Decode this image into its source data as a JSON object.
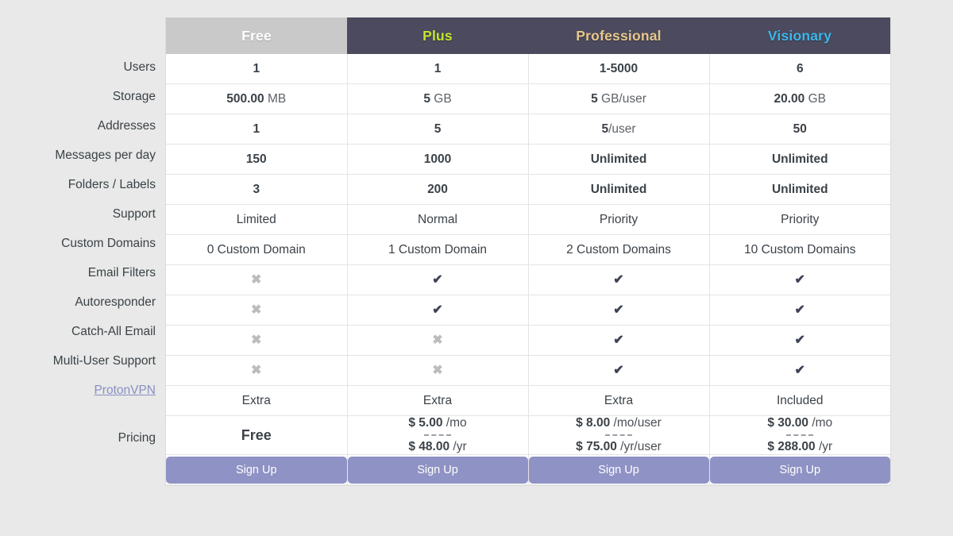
{
  "table": {
    "plans": [
      {
        "key": "free",
        "name": "Free",
        "name_color": "#ffffff",
        "header_bg": "#c9c9c9"
      },
      {
        "key": "plus",
        "name": "Plus",
        "name_color": "#c3e62e",
        "header_bg": "#4b4a5e"
      },
      {
        "key": "professional",
        "name": "Professional",
        "name_color": "#e8c88a",
        "header_bg": "#4b4a5e"
      },
      {
        "key": "visionary",
        "name": "Visionary",
        "name_color": "#3cb6e8",
        "header_bg": "#4b4a5e"
      }
    ],
    "rows": [
      {
        "label": "Users",
        "values": [
          "1",
          "1",
          "1-5000",
          "6"
        ]
      },
      {
        "label": "Storage",
        "values": [
          "500.00 MB",
          "5 GB",
          "5 GB/user",
          "20.00 GB"
        ],
        "amounts": [
          "500.00",
          "5",
          "5",
          "20.00"
        ],
        "units": [
          " MB",
          " GB",
          " GB/user",
          " GB"
        ]
      },
      {
        "label": "Addresses",
        "values": [
          "1",
          "5",
          "5/user",
          "50"
        ],
        "amounts": [
          "1",
          "5",
          "5",
          "50"
        ],
        "units": [
          "",
          "",
          "/user",
          ""
        ]
      },
      {
        "label": "Messages per day",
        "values": [
          "150",
          "1000",
          "Unlimited",
          "Unlimited"
        ]
      },
      {
        "label": "Folders / Labels",
        "values": [
          "3",
          "200",
          "Unlimited",
          "Unlimited"
        ]
      },
      {
        "label": "Support",
        "values": [
          "Limited",
          "Normal",
          "Priority",
          "Priority"
        ]
      },
      {
        "label": "Custom Domains",
        "values": [
          "0 Custom Domain",
          "1 Custom Domain",
          "2 Custom Domains",
          "10 Custom Domains"
        ]
      },
      {
        "label": "Email Filters",
        "values": [
          "cross",
          "check",
          "check",
          "check"
        ]
      },
      {
        "label": "Autoresponder",
        "values": [
          "cross",
          "check",
          "check",
          "check"
        ]
      },
      {
        "label": "Catch-All Email",
        "values": [
          "cross",
          "cross",
          "check",
          "check"
        ]
      },
      {
        "label": "Multi-User Support",
        "values": [
          "cross",
          "cross",
          "check",
          "check"
        ]
      },
      {
        "label": "ProtonVPN",
        "values": [
          "Extra",
          "Extra",
          "Extra",
          "Included"
        ]
      }
    ],
    "pricing_row": {
      "label": "Pricing",
      "cells": [
        {
          "free_label": "Free"
        },
        {
          "monthly_amount": "$ 5.00",
          "monthly_period": "/mo",
          "yearly_amount": "$ 48.00",
          "yearly_period": "/yr"
        },
        {
          "monthly_amount": "$ 8.00",
          "monthly_period": "/mo/user",
          "yearly_amount": "$ 75.00",
          "yearly_period": "/yr/user"
        },
        {
          "monthly_amount": "$ 30.00",
          "monthly_period": "/mo",
          "yearly_amount": "$ 288.00",
          "yearly_period": "/yr"
        }
      ]
    },
    "signup_buttons": [
      "Sign Up",
      "Sign Up",
      "Sign Up",
      "Sign Up"
    ],
    "icons": {
      "check": "✔",
      "cross": "✖"
    }
  },
  "colors": {
    "page_bg": "#e8e9e8",
    "header_dark": "#4b4a5e",
    "header_free": "#c9c9c9",
    "button": "#8f92c4",
    "link": "#8a8fc4",
    "text": "#3b4248",
    "muted": "#b9b9b9"
  }
}
